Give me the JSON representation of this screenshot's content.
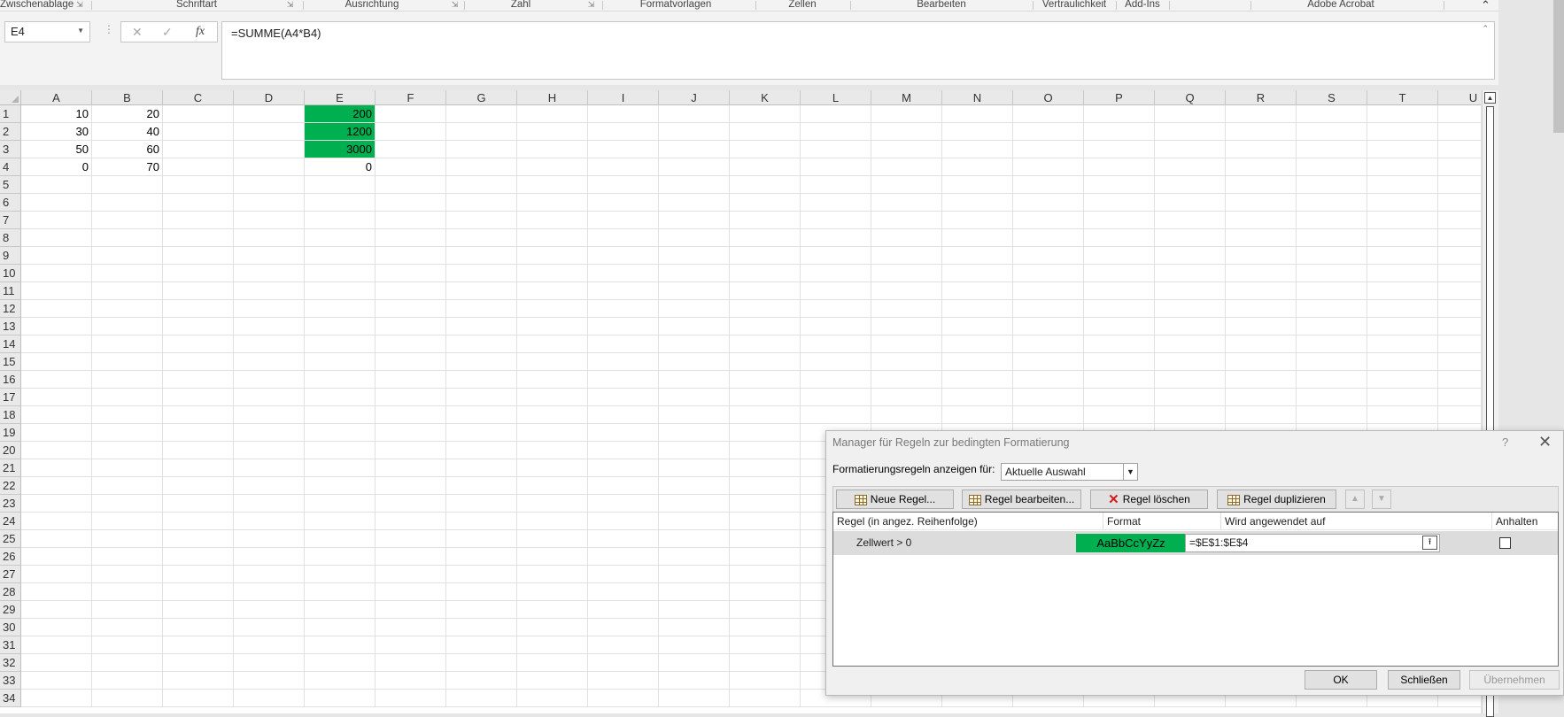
{
  "ribbon": {
    "groups": [
      "Zwischenablage",
      "Schriftart",
      "Ausrichtung",
      "Zahl",
      "Formatvorlagen",
      "Zellen",
      "Bearbeiten",
      "Vertraulichkeit",
      "Add-Ins",
      "Adobe Acrobat"
    ],
    "collapse_icon": "chevron-up-icon"
  },
  "formula_bar": {
    "name_box": "E4",
    "formula": "=SUMME(A4*B4)",
    "cancel_glyph": "✕",
    "confirm_glyph": "✓",
    "fx_label": "fx"
  },
  "sheet": {
    "columns": [
      "A",
      "B",
      "C",
      "D",
      "E",
      "F",
      "G",
      "H",
      "I",
      "J",
      "K",
      "L",
      "M",
      "N",
      "O",
      "P",
      "Q",
      "R",
      "S",
      "T",
      "U"
    ],
    "rows": [
      "1",
      "2",
      "3",
      "4",
      "5",
      "6",
      "7",
      "8",
      "9",
      "10",
      "11",
      "12",
      "13",
      "14",
      "15",
      "16",
      "17",
      "18",
      "19",
      "20",
      "21",
      "22",
      "23",
      "24",
      "25",
      "26",
      "27",
      "28",
      "29",
      "30",
      "31",
      "32",
      "33",
      "34"
    ],
    "cells": {
      "A": [
        "10",
        "30",
        "50",
        "0"
      ],
      "B": [
        "20",
        "40",
        "60",
        "70"
      ],
      "E": [
        "200",
        "1200",
        "3000",
        "0"
      ]
    },
    "highlight_color": "#00b050"
  },
  "dialog": {
    "title": "Manager für Regeln zur bedingten Formatierung",
    "help": "?",
    "close": "✕",
    "show_rules_label": "Formatierungsregeln anzeigen für:",
    "show_rules_value": "Aktuelle Auswahl",
    "buttons": {
      "new_rule": "Neue Regel...",
      "edit_rule": "Regel bearbeiten...",
      "delete_rule": "Regel löschen",
      "duplicate_rule": "Regel duplizieren",
      "move_up": "▲",
      "move_down": "▼"
    },
    "table": {
      "headers": [
        "Regel (in angez. Reihenfolge)",
        "Format",
        "Wird angewendet auf",
        "Anhalten"
      ],
      "rules": [
        {
          "rule": "Zellwert > 0",
          "format_preview": "AaBbCcYyZz",
          "applies_to": "=$E$1:$E$4",
          "stop": false
        }
      ]
    },
    "footer": {
      "ok": "OK",
      "close": "Schließen",
      "apply": "Übernehmen"
    }
  }
}
